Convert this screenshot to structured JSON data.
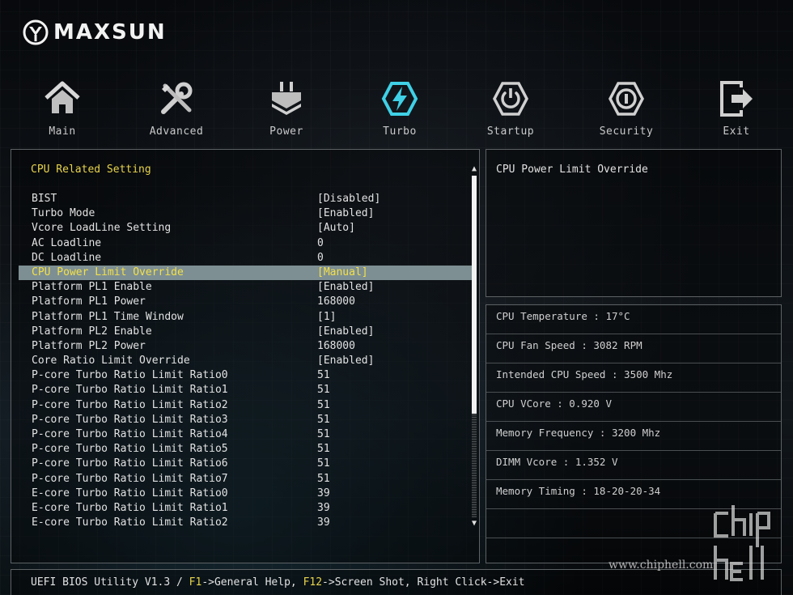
{
  "brand": {
    "name": "MAXSUN"
  },
  "nav": [
    {
      "label": "Main",
      "icon": "home-icon",
      "active": false
    },
    {
      "label": "Advanced",
      "icon": "tools-icon",
      "active": false
    },
    {
      "label": "Power",
      "icon": "power-plug-icon",
      "active": false
    },
    {
      "label": "Turbo",
      "icon": "turbo-bolt-icon",
      "active": true
    },
    {
      "label": "Startup",
      "icon": "startup-power-icon",
      "active": false
    },
    {
      "label": "Security",
      "icon": "security-shield-icon",
      "active": false
    },
    {
      "label": "Exit",
      "icon": "exit-icon",
      "active": false
    }
  ],
  "main": {
    "section_title": "CPU Related Setting",
    "settings": [
      {
        "label": "BIST",
        "value": "[Disabled]"
      },
      {
        "label": "Turbo Mode",
        "value": "[Enabled]"
      },
      {
        "label": "Vcore LoadLine Setting",
        "value": "[Auto]"
      },
      {
        "label": "AC Loadline",
        "value": "0"
      },
      {
        "label": "DC Loadline",
        "value": "0"
      },
      {
        "label": "CPU Power Limit Override",
        "value": "[Manual]",
        "selected": true
      },
      {
        "label": "Platform PL1 Enable",
        "value": "[Enabled]"
      },
      {
        "label": "Platform PL1 Power",
        "value": "168000"
      },
      {
        "label": "Platform PL1 Time Window",
        "value": "[1]"
      },
      {
        "label": "Platform PL2 Enable",
        "value": "[Enabled]"
      },
      {
        "label": "Platform PL2 Power",
        "value": "168000"
      },
      {
        "label": "Core Ratio Limit Override",
        "value": "[Enabled]"
      },
      {
        "label": "P-core Turbo Ratio Limit Ratio0",
        "value": "51"
      },
      {
        "label": "P-core Turbo Ratio Limit Ratio1",
        "value": "51"
      },
      {
        "label": "P-core Turbo Ratio Limit Ratio2",
        "value": "51"
      },
      {
        "label": "P-core Turbo Ratio Limit Ratio3",
        "value": "51"
      },
      {
        "label": "P-core Turbo Ratio Limit Ratio4",
        "value": "51"
      },
      {
        "label": "P-core Turbo Ratio Limit Ratio5",
        "value": "51"
      },
      {
        "label": "P-core Turbo Ratio Limit Ratio6",
        "value": "51"
      },
      {
        "label": "P-core Turbo Ratio Limit Ratio7",
        "value": "51"
      },
      {
        "label": "E-core Turbo Ratio Limit Ratio0",
        "value": "39"
      },
      {
        "label": "E-core Turbo Ratio Limit Ratio1",
        "value": "39"
      },
      {
        "label": "E-core Turbo Ratio Limit Ratio2",
        "value": "39"
      }
    ]
  },
  "help": {
    "text": "CPU Power Limit Override"
  },
  "info": [
    "CPU Temperature : 17°C",
    "CPU Fan Speed : 3082 RPM",
    "Intended CPU Speed : 3500 Mhz",
    "CPU VCore : 0.920 V",
    "Memory Frequency : 3200 Mhz",
    "DIMM Vcore : 1.352 V",
    "Memory Timing : 18-20-20-34"
  ],
  "footer": {
    "prefix": "UEFI BIOS Utility V1.3 / ",
    "key1": "F1",
    "text1": "->General Help, ",
    "key2": "F12",
    "text2": "->Screen Shot, Right Click->Exit"
  },
  "watermark": {
    "text": "www.chiphell.com",
    "logo_text": "chip hell"
  },
  "colors": {
    "accent_yellow": "#e8d44d",
    "selection_bg": "#7d8f92",
    "turbo_cyan": "#3fd0e6",
    "border": "#5d6265"
  }
}
